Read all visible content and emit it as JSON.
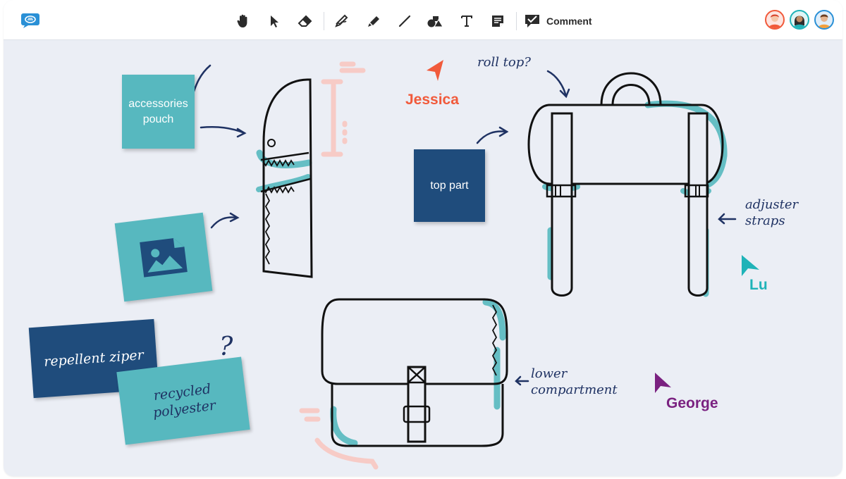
{
  "toolbar": {
    "tools": [
      {
        "name": "hand-tool",
        "icon": "hand-icon"
      },
      {
        "name": "select-tool",
        "icon": "pointer-icon"
      },
      {
        "name": "eraser-tool",
        "icon": "eraser-icon"
      },
      {
        "name": "pen-tool",
        "icon": "pen-icon"
      },
      {
        "name": "marker-tool",
        "icon": "marker-icon"
      },
      {
        "name": "line-tool",
        "icon": "line-icon"
      },
      {
        "name": "shapes-tool",
        "icon": "shapes-icon"
      },
      {
        "name": "text-tool",
        "icon": "text-icon"
      },
      {
        "name": "sticky-note-tool",
        "icon": "sticky-note-icon"
      }
    ],
    "comment_label": "Comment",
    "participants": [
      "avatar-red",
      "avatar-teal",
      "avatar-blue"
    ]
  },
  "notes": {
    "accessories": "accessories\npouch",
    "top_part": "top part",
    "repellent": "repellent ziper",
    "recycled": "recycled\npolyester"
  },
  "annotations": {
    "roll_top": "roll top?",
    "adjuster": "adjuster\nstraps",
    "lower": "lower\ncompartment",
    "question": "?"
  },
  "cursors": {
    "jessica": "Jessica",
    "lu": "Lu",
    "george": "George"
  },
  "colors": {
    "brand": "#2a90d6",
    "teal": "#57b8bf",
    "navy": "#1f4c7c",
    "ink": "#1f3263",
    "jessica": "#f15a3b",
    "lu": "#1fb3b8",
    "george": "#7a2180",
    "pink": "#f7cbc6"
  }
}
